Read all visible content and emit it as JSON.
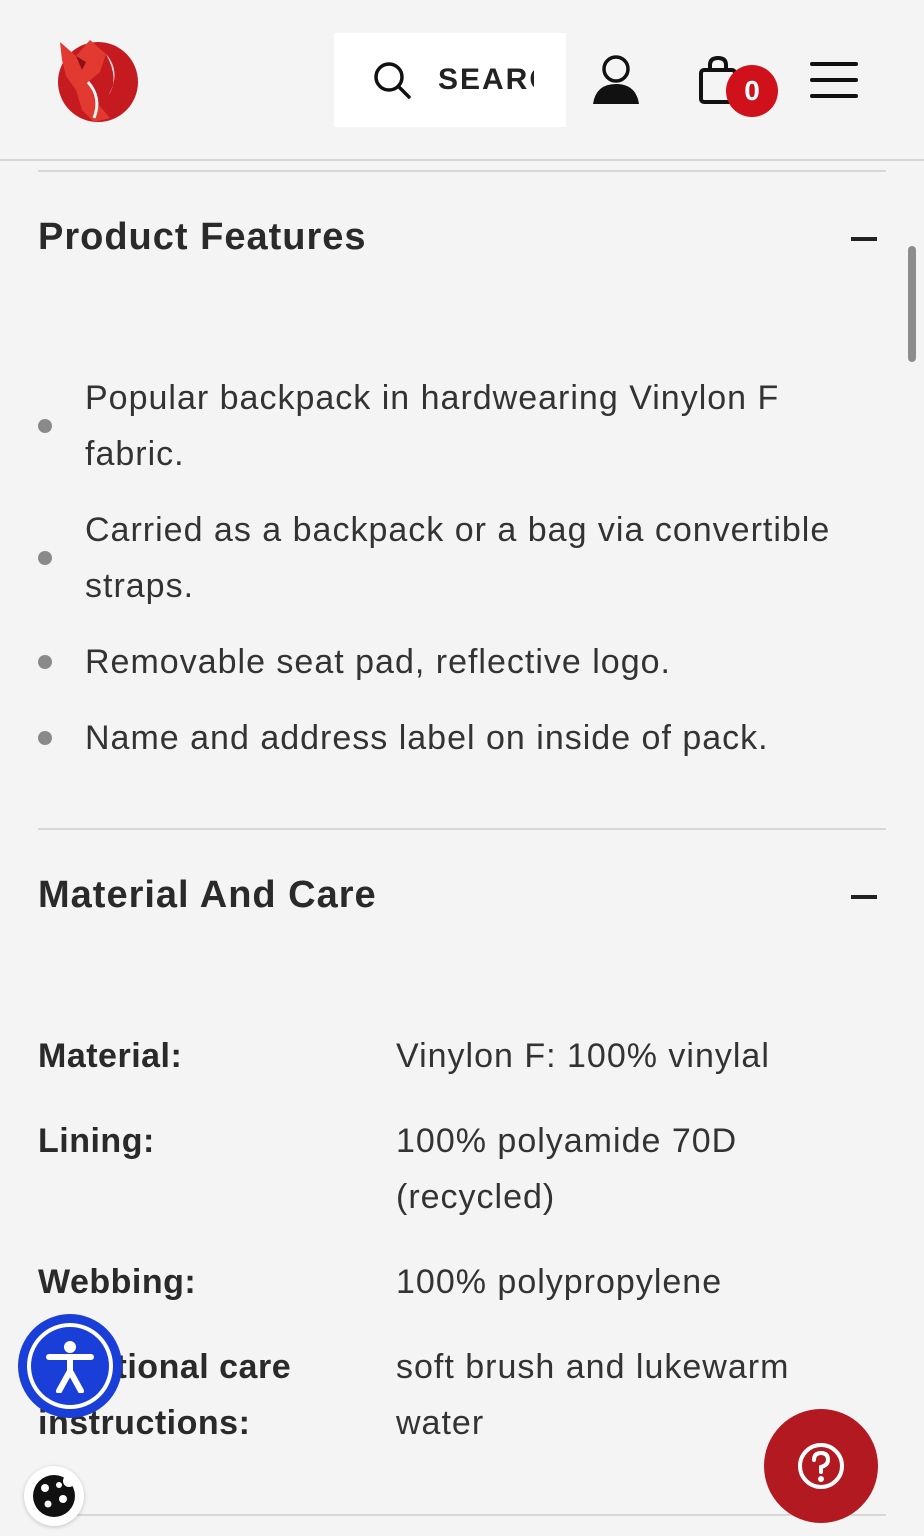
{
  "header": {
    "logo_icon": "fox-logo-icon",
    "brand_color": "#c41a20",
    "search": {
      "label": "SEARCH",
      "icon": "search-icon"
    },
    "account_icon": "user-icon",
    "cart": {
      "icon": "shopping-bag-icon",
      "count": "0",
      "badge_color": "#d0111b"
    },
    "menu_icon": "hamburger-menu-icon"
  },
  "product_features": {
    "title": "Product Features",
    "toggle_icon": "minus-icon",
    "items": [
      "Popular backpack in hardwearing Vinylon F fabric.",
      "Carried as a backpack or a bag via convertible straps.",
      "Removable seat pad, reflective logo.",
      "Name and address label on inside of pack."
    ]
  },
  "material_care": {
    "title": "Material And Care",
    "toggle_icon": "minus-icon",
    "rows": [
      {
        "key": "Material:",
        "value": "Vinylon F: 100% vinylal"
      },
      {
        "key": "Lining:",
        "value": "100% polyamide 70D (recycled)"
      },
      {
        "key": "Webbing:",
        "value": "100% polypropylene"
      },
      {
        "key": "Additional care instructions:",
        "value": "soft brush and lukewarm water"
      }
    ]
  },
  "floating": {
    "accessibility_icon": "accessibility-icon",
    "accessibility_color": "#1a3fd8",
    "cookie_icon": "cookie-icon",
    "help_icon": "help-question-icon",
    "help_color": "#b21920"
  }
}
